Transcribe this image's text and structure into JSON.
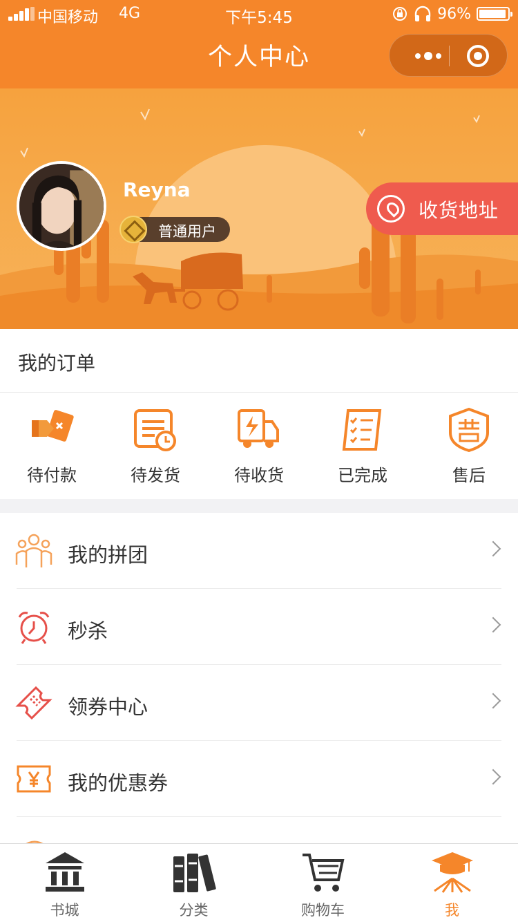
{
  "status_bar": {
    "carrier": "中国移动",
    "network": "4G",
    "time": "下午5:45",
    "battery": "96%"
  },
  "nav": {
    "title": "个人中心",
    "more_icon": "more-dots-icon",
    "close_icon": "record-circle-icon"
  },
  "profile": {
    "username": "Reyna",
    "level": "普通用户",
    "address_button": "收货地址"
  },
  "orders": {
    "title": "我的订单",
    "items": [
      {
        "label": "待付款",
        "icon": "wallet-icon"
      },
      {
        "label": "待发货",
        "icon": "document-clock-icon"
      },
      {
        "label": "待收货",
        "icon": "delivery-truck-icon"
      },
      {
        "label": "已完成",
        "icon": "checklist-icon"
      },
      {
        "label": "售后",
        "icon": "after-sales-shield-icon"
      }
    ]
  },
  "menu": [
    {
      "label": "我的拼团",
      "icon": "group-people-icon"
    },
    {
      "label": "秒杀",
      "icon": "alarm-clock-icon"
    },
    {
      "label": "领券中心",
      "icon": "ticket-icon"
    },
    {
      "label": "我的优惠券",
      "icon": "yen-coupon-icon"
    }
  ],
  "tabbar": [
    {
      "label": "书城",
      "icon": "bank-icon",
      "active": false
    },
    {
      "label": "分类",
      "icon": "books-icon",
      "active": false
    },
    {
      "label": "购物车",
      "icon": "cart-icon",
      "active": false
    },
    {
      "label": "我",
      "icon": "graduation-cap-icon",
      "active": true
    }
  ],
  "colors": {
    "brand_orange": "#f5862a",
    "address_red": "#ef5b4e",
    "tab_inactive": "#666666"
  }
}
